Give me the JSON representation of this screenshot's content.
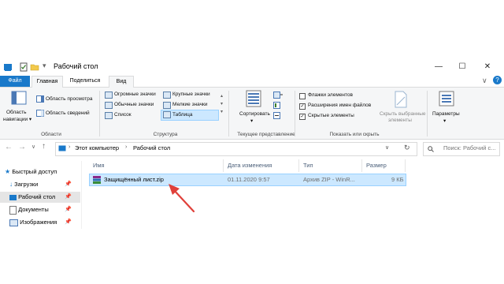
{
  "window": {
    "title": "Рабочий стол"
  },
  "tabs": {
    "file": "Файл",
    "home": "Главная",
    "share": "Поделиться",
    "view": "Вид"
  },
  "ribbon": {
    "panels": {
      "nav_pane": "Область навигации",
      "nav_pane_line1": "Область",
      "nav_pane_line2": "навигации",
      "preview_pane": "Область просмотра",
      "details_pane": "Область сведений",
      "group_label": "Области"
    },
    "layout": {
      "huge_icons": "Огромные значки",
      "large_icons": "Крупные значки",
      "normal_icons": "Обычные значки",
      "small_icons": "Мелкие значки",
      "list": "Список",
      "table": "Таблица",
      "group_label": "Структура"
    },
    "current_view": {
      "sort_line1": "Сортировать",
      "sort_line2": "",
      "group_label": "Текущее представление"
    },
    "show_hide": {
      "item_checkboxes": "Флажки элементов",
      "file_extensions": "Расширения имен файлов",
      "hidden_items": "Скрытые элементы",
      "hide_selected_line1": "Скрыть выбранные",
      "hide_selected_line2": "элементы",
      "group_label": "Показать или скрыть",
      "item_checkboxes_checked": false,
      "file_extensions_checked": true,
      "hidden_items_checked": true
    },
    "options": {
      "label": "Параметры"
    }
  },
  "address": {
    "crumb1": "Этот компьютер",
    "crumb2": "Рабочий стол",
    "search_placeholder": "Поиск: Рабочий с..."
  },
  "sidebar": {
    "quick_access": "Быстрый доступ",
    "items": [
      {
        "label": "Загрузки"
      },
      {
        "label": "Рабочий стол"
      },
      {
        "label": "Документы"
      },
      {
        "label": "Изображения"
      }
    ]
  },
  "columns": {
    "name": "Имя",
    "date": "Дата изменения",
    "type": "Тип",
    "size": "Размер"
  },
  "files": [
    {
      "name": "Защищённый лист.zip",
      "date": "01.11.2020 9:57",
      "type": "Архив ZIP - WinR...",
      "size": "9 КБ"
    }
  ],
  "colors": {
    "accent": "#1979ca",
    "selection": "#cce8ff",
    "arrow": "#e0403a"
  }
}
